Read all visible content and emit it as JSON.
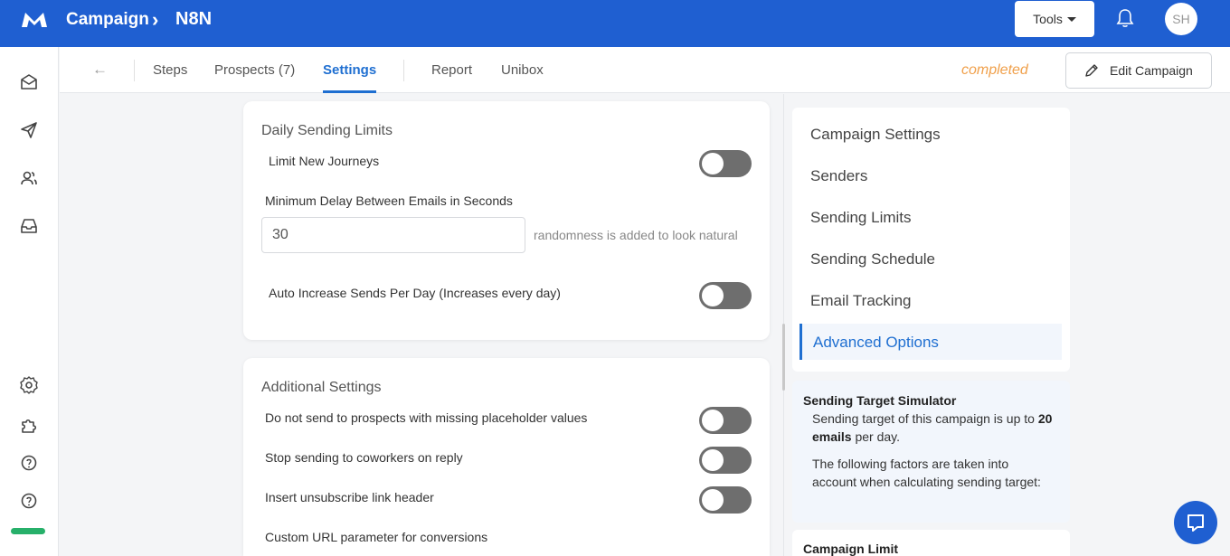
{
  "header": {
    "breadcrumb_root": "Campaign",
    "breadcrumb_sep": "›",
    "breadcrumb_current": "N8N",
    "tools_label": "Tools",
    "avatar_initials": "SH",
    "brand_color": "#1f5fd1"
  },
  "subnav": {
    "back_label": "←",
    "tabs": [
      {
        "label": "Steps"
      },
      {
        "label": "Prospects (7)"
      },
      {
        "label": "Settings",
        "active": true
      },
      {
        "label": "Report"
      },
      {
        "label": "Unibox"
      }
    ],
    "status": "completed",
    "edit_label": "Edit Campaign"
  },
  "sidebar": {
    "icons": [
      "mail-icon",
      "send-icon",
      "users-icon",
      "inbox-icon",
      "settings-icon",
      "puzzle-icon",
      "help-icon",
      "help-circle-icon"
    ]
  },
  "daily_limits": {
    "title": "Daily Sending Limits",
    "limit_new_journeys": "Limit New Journeys",
    "min_delay_label": "Minimum Delay Between Emails in Seconds",
    "min_delay_value": "30",
    "min_delay_hint": "randomness is added to look natural",
    "auto_increase": "Auto Increase Sends Per Day (Increases every day)"
  },
  "additional": {
    "title": "Additional Settings",
    "missing_placeholder": "Do not send to prospects with missing placeholder values",
    "stop_coworkers": "Stop sending to coworkers on reply",
    "unsubscribe_header": "Insert unsubscribe link header",
    "custom_url": "Custom URL parameter for conversions"
  },
  "settings_nav": {
    "items": [
      {
        "label": "Campaign Settings"
      },
      {
        "label": "Senders"
      },
      {
        "label": "Sending Limits"
      },
      {
        "label": "Sending Schedule"
      },
      {
        "label": "Email Tracking"
      },
      {
        "label": "Advanced Options",
        "active": true
      }
    ]
  },
  "simulator": {
    "title": "Sending Target Simulator",
    "line1_prefix": "Sending target of this campaign is up to",
    "line1_bold": "20 emails",
    "line1_suffix": "per day.",
    "factors": "The following factors are taken into account when calculating sending target:",
    "next_title": "Campaign Limit"
  }
}
